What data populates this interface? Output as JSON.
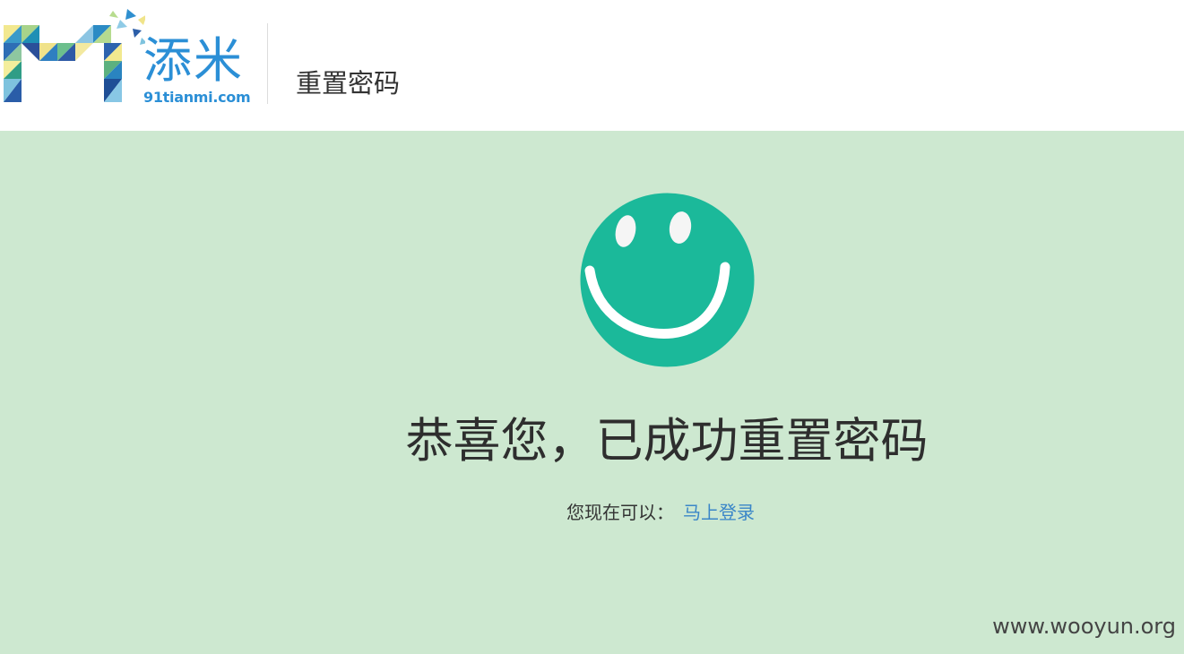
{
  "header": {
    "logo_text_cn": "添米",
    "logo_text_en": "91tianmi.com",
    "page_title": "重置密码"
  },
  "main": {
    "heading": "恭喜您，已成功重置密码",
    "next_step_prefix": "您现在可以：",
    "login_link": "马上登录",
    "watermark": "www.wooyun.org"
  },
  "colors": {
    "page_background": "#cde8d0",
    "smiley": "#1bb99a",
    "link": "#3a86c8",
    "brand_blue": "#2b8fd6"
  },
  "icons": {
    "success": "smiley-face-icon",
    "logo": "mosaic-m-logo"
  }
}
